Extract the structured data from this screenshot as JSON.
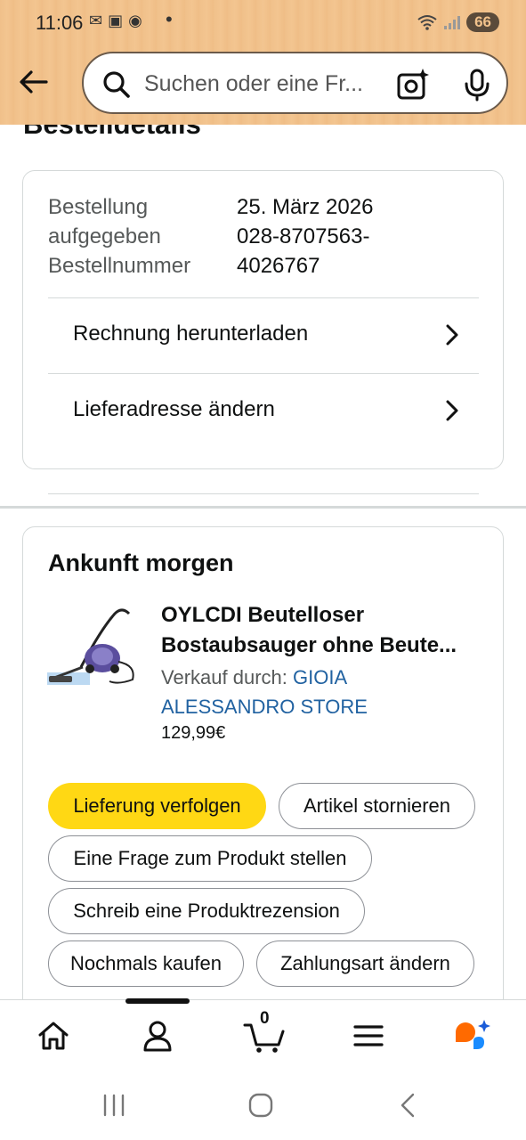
{
  "status_bar": {
    "time": "11:06",
    "battery": "66"
  },
  "search": {
    "placeholder": "Suchen oder eine Fr..."
  },
  "page": {
    "title": "Bestelldetails"
  },
  "order": {
    "labels": [
      "Bestellung",
      "aufgegeben",
      "Bestellnummer"
    ],
    "values": [
      "25. März 2026",
      "028-8707563-",
      "4026767"
    ],
    "actions": [
      {
        "label": "Rechnung herunterladen"
      },
      {
        "label": "Lieferadresse ändern"
      }
    ]
  },
  "shipment": {
    "arrival": "Ankunft morgen",
    "product": {
      "title_line1": "OYLCDI Beutelloser",
      "title_line2": "Bostaubsauger ohne Beute...",
      "sold_by_label": "Verkauf durch:",
      "seller_line1": "GIOIA",
      "seller_line2": "ALESSANDRO STORE",
      "price": "129,99€"
    },
    "buttons": {
      "track": "Lieferung verfolgen",
      "cancel": "Artikel stornieren",
      "question": "Eine Frage zum Produkt stellen",
      "review": "Schreib eine Produktrezension",
      "buy_again": "Nochmals kaufen",
      "payment": "Zahlungsart ändern"
    }
  },
  "bottom_nav": {
    "cart_count": "0"
  },
  "colors": {
    "header": "#f2c28c",
    "primary_button": "#ffd814",
    "link": "#2162a1",
    "rufus_orange": "#ff6a00",
    "rufus_blue": "#1a8cff"
  }
}
